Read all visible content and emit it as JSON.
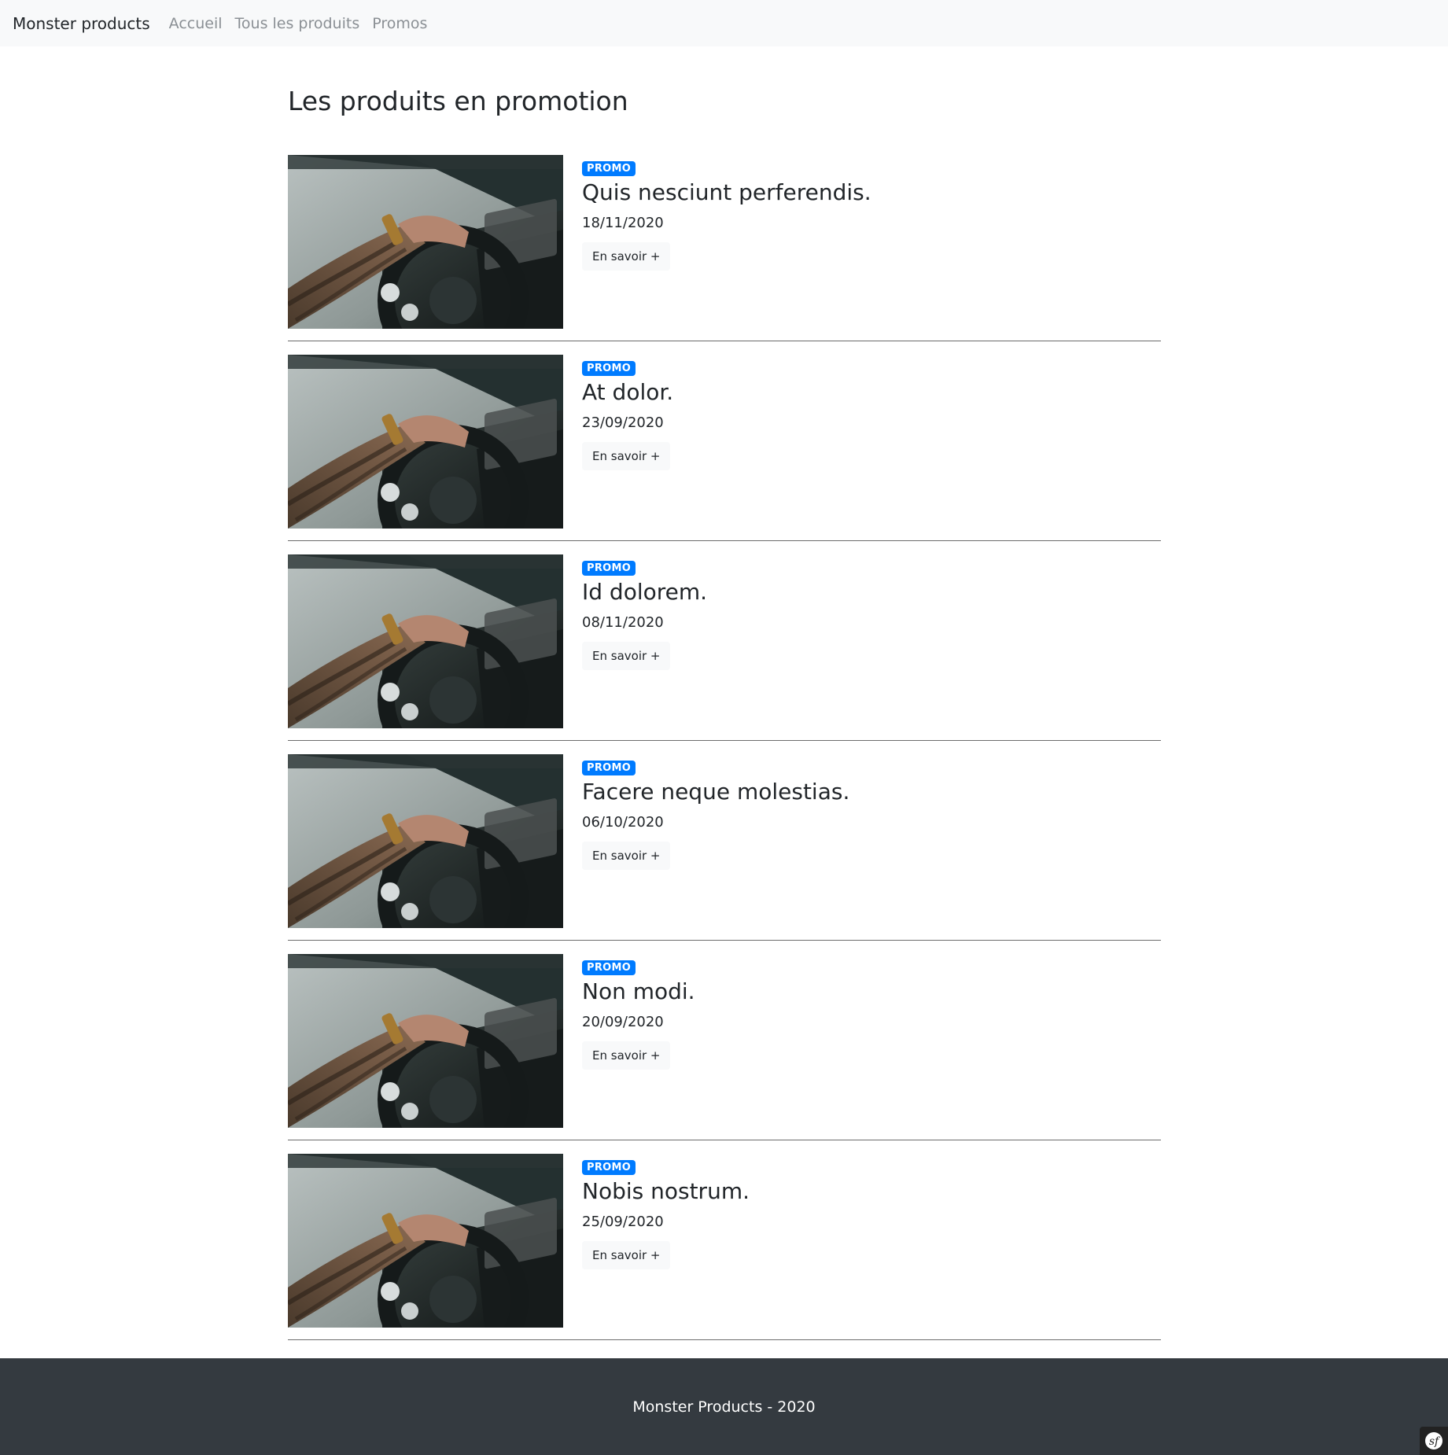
{
  "navbar": {
    "brand": "Monster products",
    "links": [
      "Accueil",
      "Tous les produits",
      "Promos"
    ]
  },
  "page": {
    "title": "Les produits en promotion"
  },
  "products": [
    {
      "badge": "PROMO",
      "title": "Quis nesciunt perferendis.",
      "date": "18/11/2020",
      "button": "En savoir +"
    },
    {
      "badge": "PROMO",
      "title": "At dolor.",
      "date": "23/09/2020",
      "button": "En savoir +"
    },
    {
      "badge": "PROMO",
      "title": "Id dolorem.",
      "date": "08/11/2020",
      "button": "En savoir +"
    },
    {
      "badge": "PROMO",
      "title": "Facere neque molestias.",
      "date": "06/10/2020",
      "button": "En savoir +"
    },
    {
      "badge": "PROMO",
      "title": "Non modi.",
      "date": "20/09/2020",
      "button": "En savoir +"
    },
    {
      "badge": "PROMO",
      "title": "Nobis nostrum.",
      "date": "25/09/2020",
      "button": "En savoir +"
    }
  ],
  "footer": {
    "text": "Monster Products - 2020"
  },
  "colors": {
    "badge": "#007bff",
    "navbar_bg": "#f8f9fa",
    "footer_bg": "#343a40"
  },
  "icons": {
    "toolbar": "symfony-logo-icon"
  }
}
